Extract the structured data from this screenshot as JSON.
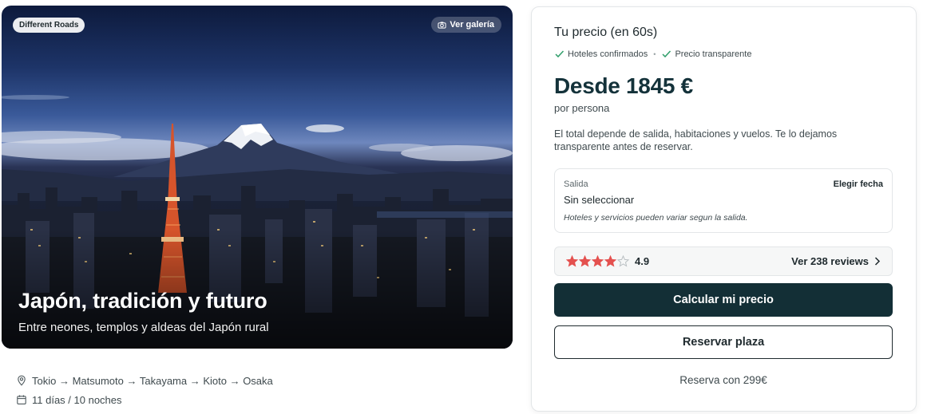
{
  "hero": {
    "badge": "Different Roads",
    "gallery_label": "Ver galería",
    "title": "Japón, tradición y futuro",
    "subtitle": "Entre neones, templos y aldeas del Japón rural"
  },
  "meta": {
    "route": "Tokio → Matsumoto → Takayama → Kioto → Osaka",
    "duration": "11 días / 10 noches"
  },
  "card": {
    "title": "Tu precio (en 60s)",
    "check_1": "Hoteles confirmados",
    "check_2": "Precio transparente",
    "price": "Desde 1845 €",
    "per_person": "por persona",
    "description": "El total depende de salida, habitaciones y vuelos. Te lo dejamos transparente antes de reservar.",
    "salida": {
      "label": "Salida",
      "choose": "Elegir fecha",
      "value": "Sin seleccionar",
      "note": "Hoteles y servicios pueden variar segun la salida."
    },
    "rating": {
      "stars_filled": 4,
      "stars_total": 5,
      "score": "4.9",
      "reviews_link": "Ver 238 reviews"
    },
    "primary_button": "Calcular mi precio",
    "secondary_button": "Reservar plaza",
    "deposit": "Reserva con 299€"
  },
  "colors": {
    "primary": "#132f36",
    "star": "#e4514f",
    "check": "#2f9e6a"
  }
}
